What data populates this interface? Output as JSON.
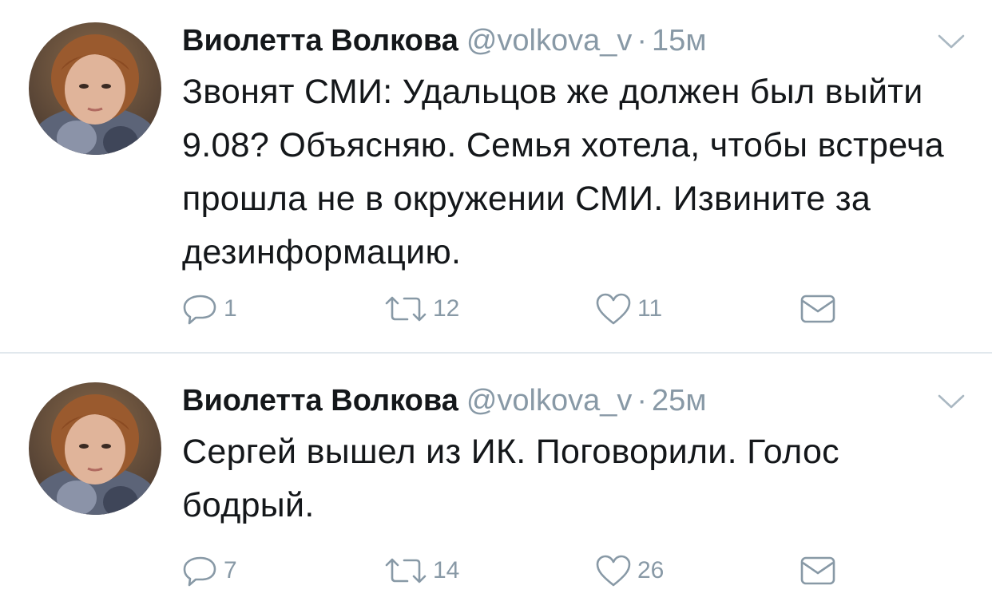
{
  "tweets": [
    {
      "author_name": "Виолетта Волкова",
      "handle": "@volkova_v",
      "separator": "·",
      "time": "15м",
      "text": "Звонят СМИ: Удальцов же должен был выйти 9.08? Объясняю. Семья хотела, чтобы встреча прошла не в окружении СМИ. Извините за дезинформацию.",
      "replies": "1",
      "retweets": "12",
      "likes": "11"
    },
    {
      "author_name": "Виолетта Волкова",
      "handle": "@volkova_v",
      "separator": "·",
      "time": "25м",
      "text": "Сергей вышел из ИК. Поговорили. Голос бодрый.",
      "replies": "7",
      "retweets": "14",
      "likes": "26"
    }
  ],
  "icons": {
    "reply": "reply-icon",
    "retweet": "retweet-icon",
    "like": "heart-icon",
    "dm": "envelope-icon",
    "menu": "chevron-down-icon"
  },
  "colors": {
    "text": "#14171a",
    "secondary": "#8899a6",
    "divider": "#e1e8ed",
    "background": "#ffffff"
  }
}
